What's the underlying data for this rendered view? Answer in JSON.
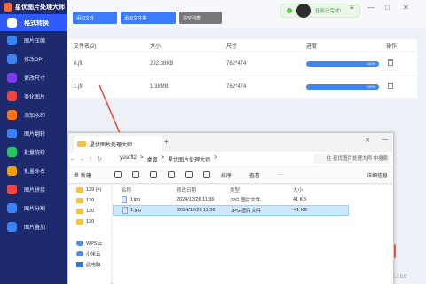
{
  "app": {
    "title": "星优图片处理大师",
    "version": "v1.7.0.0"
  },
  "sidebar": {
    "items": [
      {
        "label": "格式转换",
        "color": "#ffffff",
        "active": true
      },
      {
        "label": "图片压缩",
        "color": "#3b82f6"
      },
      {
        "label": "修改DPI",
        "color": "#3b82f6"
      },
      {
        "label": "更改尺寸",
        "color": "#7c3aed"
      },
      {
        "label": "美化图片",
        "color": "#ef4444"
      },
      {
        "label": "添加水印",
        "color": "#f97316"
      },
      {
        "label": "图片翻转",
        "color": "#3b82f6"
      },
      {
        "label": "批量旋转",
        "color": "#22c55e"
      },
      {
        "label": "批量命名",
        "color": "#f59e0b"
      },
      {
        "label": "图片拼接",
        "color": "#ef4444"
      },
      {
        "label": "图片分割",
        "color": "#3b82f6"
      },
      {
        "label": "图片叠加",
        "color": "#3b82f6"
      }
    ]
  },
  "toolbar": {
    "add_file": "添加文件",
    "add_folder": "添加文件夹",
    "clear": "清空列表"
  },
  "toast": {
    "text": "恭喜您，任务已完成!"
  },
  "window_controls": {
    "menu": "≡",
    "minimize": "—",
    "maximize": "□",
    "close": "✕"
  },
  "file_table": {
    "headers": {
      "name": "文件名(2)",
      "size": "大小",
      "dims": "尺寸",
      "progress": "进度",
      "ops": "操作"
    },
    "rows": [
      {
        "name": "0.jfif",
        "size": "232.38KB",
        "dims": "762*474",
        "progress": "100%"
      },
      {
        "name": "1.jfif",
        "size": "1.38MB",
        "dims": "762*474",
        "progress": "100%"
      }
    ]
  },
  "explorer": {
    "tab_title": "星优图片处理大师",
    "breadcrumb": [
      "yssoft2",
      ">",
      "桌面",
      ">",
      "星优图片处理大师",
      ">"
    ],
    "search_placeholder": "在 星优图片处理大师 中搜索",
    "commands": {
      "new": "新建",
      "sort": "排序",
      "view": "查看",
      "more": "···",
      "details": "详细信息"
    },
    "nav_items": [
      {
        "label": "129 (4)"
      },
      {
        "label": "130"
      },
      {
        "label": "130"
      },
      {
        "label": "130"
      },
      {
        "label": "WPS云"
      },
      {
        "label": "小米云"
      },
      {
        "label": "此电脑"
      }
    ],
    "columns": {
      "name": "名称",
      "date": "修改日期",
      "type": "类型",
      "size": "大小"
    },
    "files": [
      {
        "name": "0.jpg",
        "date": "2024/12/26 11:36",
        "type": "JPG 图片文件",
        "size": "41 KB"
      },
      {
        "name": "1.jpg",
        "date": "2024/12/26 11:36",
        "type": "JPG 图片文件",
        "size": "41 KB"
      }
    ]
  }
}
